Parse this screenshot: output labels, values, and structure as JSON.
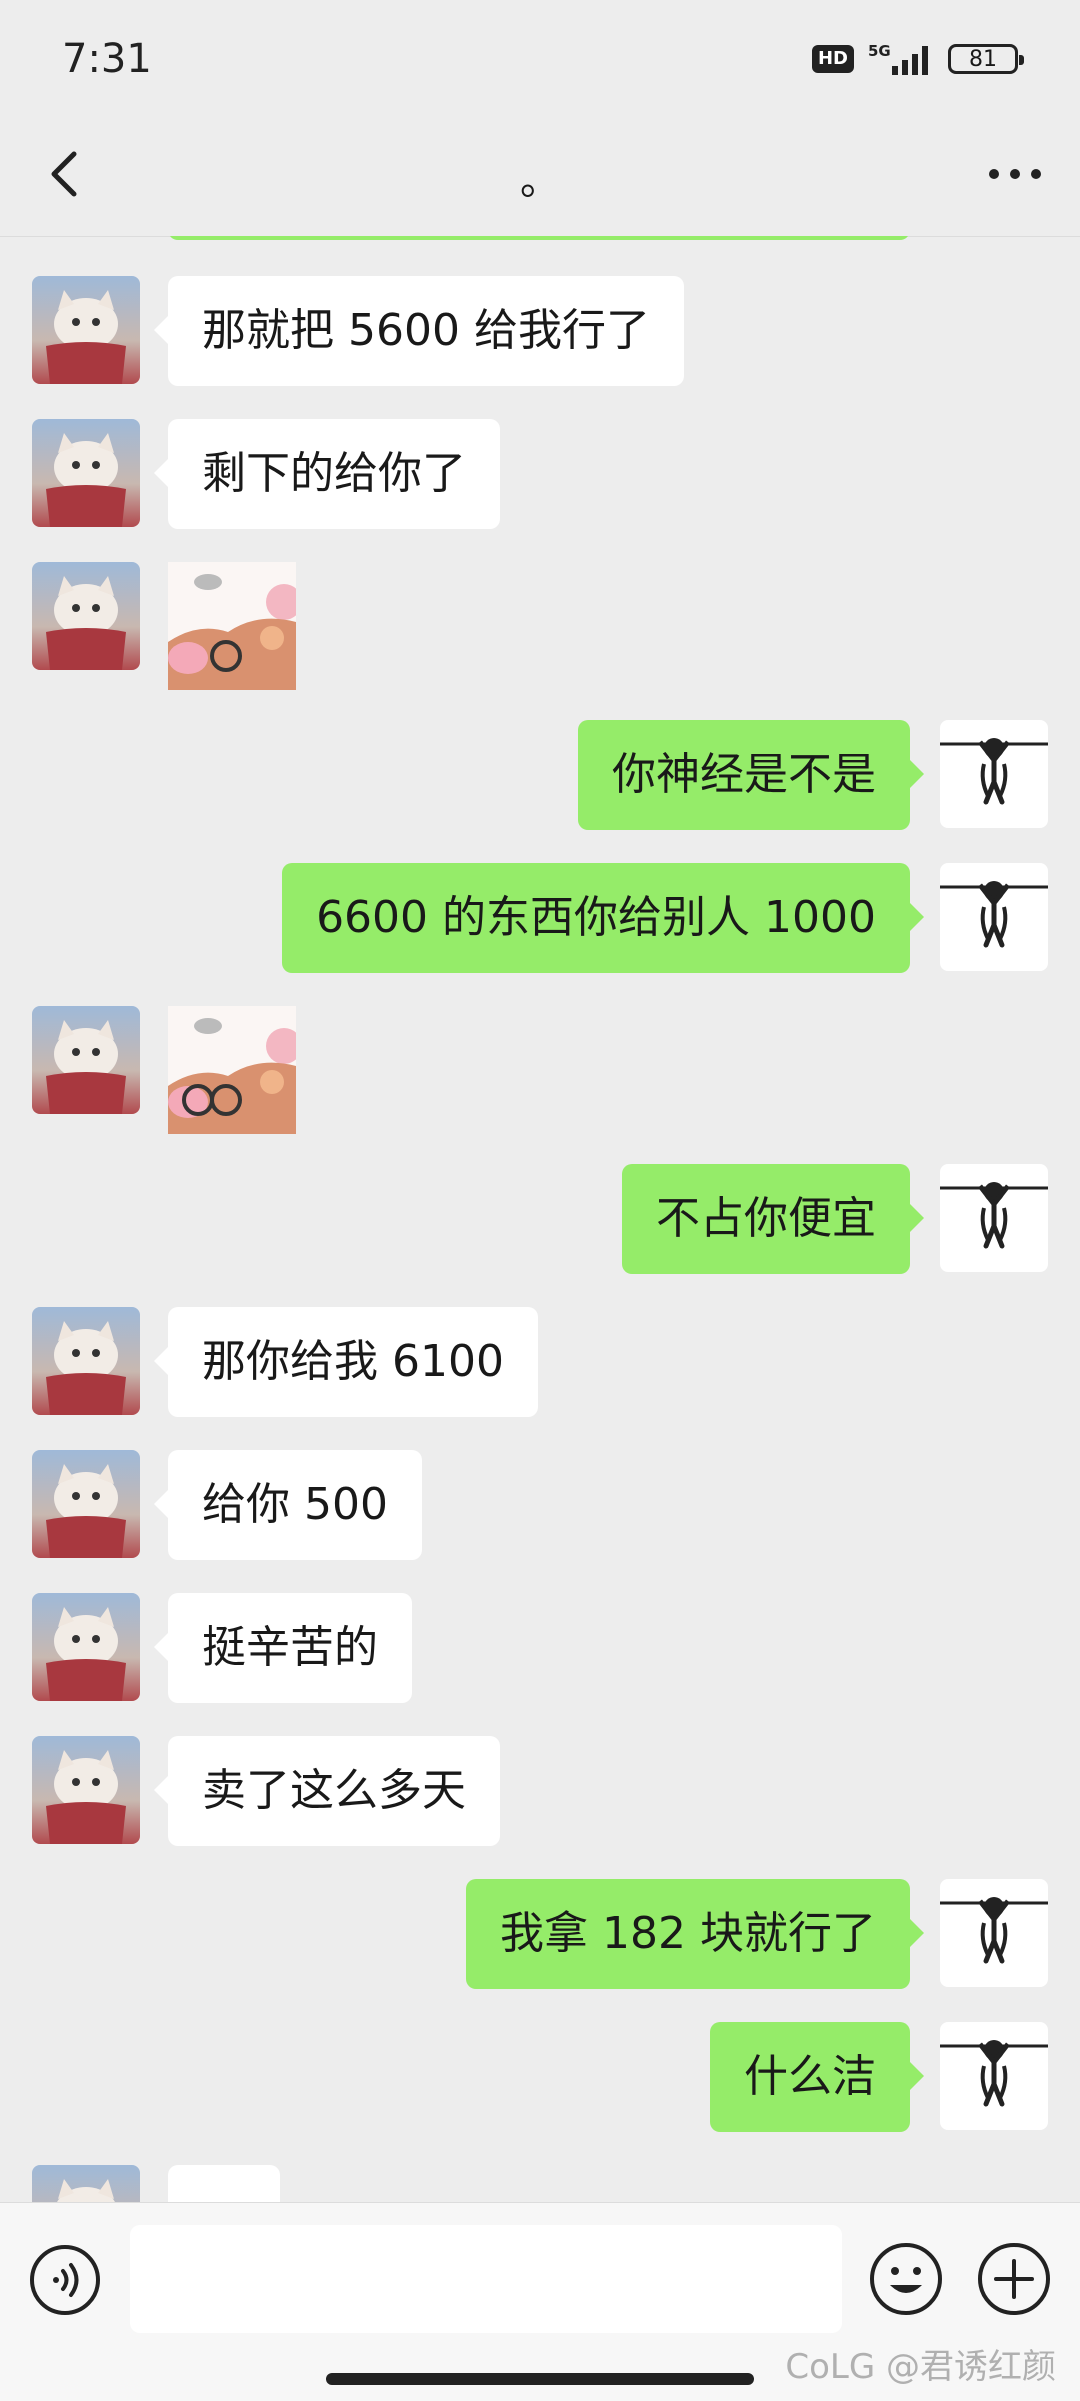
{
  "status": {
    "time": "7:31",
    "hd": "HD",
    "network": "5G",
    "battery": "81"
  },
  "header": {
    "title": "。"
  },
  "messages": [
    {
      "side": "left",
      "text": "那就把 5600 给我行了"
    },
    {
      "side": "left",
      "text": "剩下的给你了"
    },
    {
      "side": "left",
      "type": "sticker"
    },
    {
      "side": "right",
      "text": "你神经是不是"
    },
    {
      "side": "right",
      "text": "6600 的东西你给别人 1000"
    },
    {
      "side": "left",
      "type": "sticker"
    },
    {
      "side": "right",
      "text": "不占你便宜"
    },
    {
      "side": "left",
      "text": "那你给我 6100"
    },
    {
      "side": "left",
      "text": "给你 500"
    },
    {
      "side": "left",
      "text": "挺辛苦的"
    },
    {
      "side": "left",
      "text": "卖了这么多天"
    },
    {
      "side": "right",
      "text": "我拿 182 块就行了"
    },
    {
      "side": "right",
      "text": "什么洁"
    },
    {
      "side": "left",
      "text": ""
    }
  ],
  "input": {
    "placeholder": ""
  },
  "watermark": "CoLG @君诱红颜",
  "colors": {
    "outgoing": "#95ec69",
    "incoming": "#ffffff",
    "background": "#ededed"
  }
}
